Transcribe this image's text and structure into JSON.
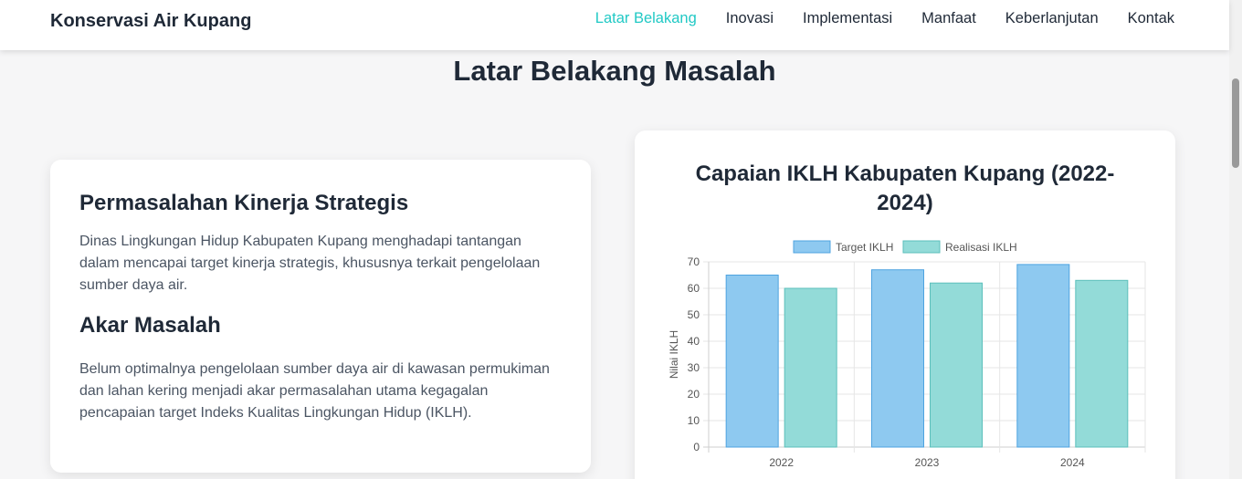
{
  "nav": {
    "brand": "Konservasi Air Kupang",
    "links": [
      "Latar Belakang",
      "Inovasi",
      "Implementasi",
      "Manfaat",
      "Keberlanjutan",
      "Kontak"
    ],
    "active": "Latar Belakang"
  },
  "section": {
    "title": "Latar Belakang Masalah"
  },
  "left_card": {
    "heading1": "Permasalahan Kinerja Strategis",
    "paragraph1": "Dinas Lingkungan Hidup Kabupaten Kupang menghadapi tantangan dalam mencapai target kinerja strategis, khususnya terkait pengelolaan sumber daya air.",
    "heading2": "Akar Masalah",
    "paragraph2": "Belum optimalnya pengelolaan sumber daya air di kawasan permukiman dan lahan kering menjadi akar permasalahan utama kegagalan pencapaian target Indeks Kualitas Lingkungan Hidup (IKLH)."
  },
  "colors": {
    "accent": "#21c9c5",
    "target_fill": "#8ec9f0",
    "target_stroke": "#4ea3e0",
    "realisasi_fill": "#93dbd8",
    "realisasi_stroke": "#5bbfbb"
  },
  "chart_data": {
    "type": "bar",
    "title": "Capaian IKLH Kabupaten Kupang (2022-2024)",
    "categories": [
      "2022",
      "2023",
      "2024"
    ],
    "series": [
      {
        "name": "Target IKLH",
        "values": [
          65,
          67,
          69
        ]
      },
      {
        "name": "Realisasi IKLH",
        "values": [
          60,
          62,
          63
        ]
      }
    ],
    "ylabel": "Nilai IKLH",
    "ylim": [
      0,
      70
    ],
    "yticks": [
      0,
      10,
      20,
      30,
      40,
      50,
      60,
      70
    ],
    "grid": true,
    "legend": "top"
  }
}
